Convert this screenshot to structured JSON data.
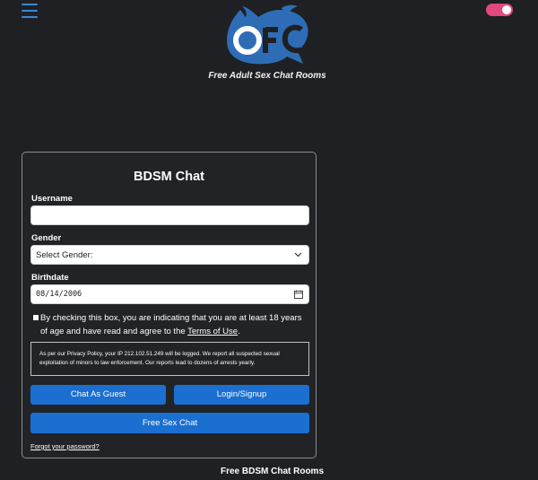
{
  "header": {
    "menu_icon": "hamburger-icon",
    "logo_text": "OFC",
    "tagline": "Free Adult Sex Chat Rooms",
    "theme_toggle_state": "on",
    "colors": {
      "accent_blue": "#1a6fd1",
      "logo_blue": "#2e6db6",
      "toggle_pink": "#e0487f",
      "background": "#1f2023"
    }
  },
  "form": {
    "title": "BDSM Chat",
    "username_label": "Username",
    "username_value": "",
    "gender_label": "Gender",
    "gender_selected": "Select Gender:",
    "birthdate_label": "Birthdate",
    "birthdate_value": "08/14/2006",
    "agree_text": "By checking this box, you are indicating that you are at least 18 years of age and have read and agree to the ",
    "terms_link": "Terms of Use",
    "agree_end": ".",
    "privacy_notice": "As per our Privacy Policy, your IP 212.102.51.249 will be logged. We report all suspected sexual exploitation of minors to law enforcement. Our reports lead to dozens of arrests yearly.",
    "guest_button": "Chat As Guest",
    "login_button": "Login/Signup",
    "free_chat_button": "Free Sex Chat",
    "forgot_link": "Forgot your password?"
  },
  "footer": {
    "text": "Free BDSM Chat Rooms"
  }
}
